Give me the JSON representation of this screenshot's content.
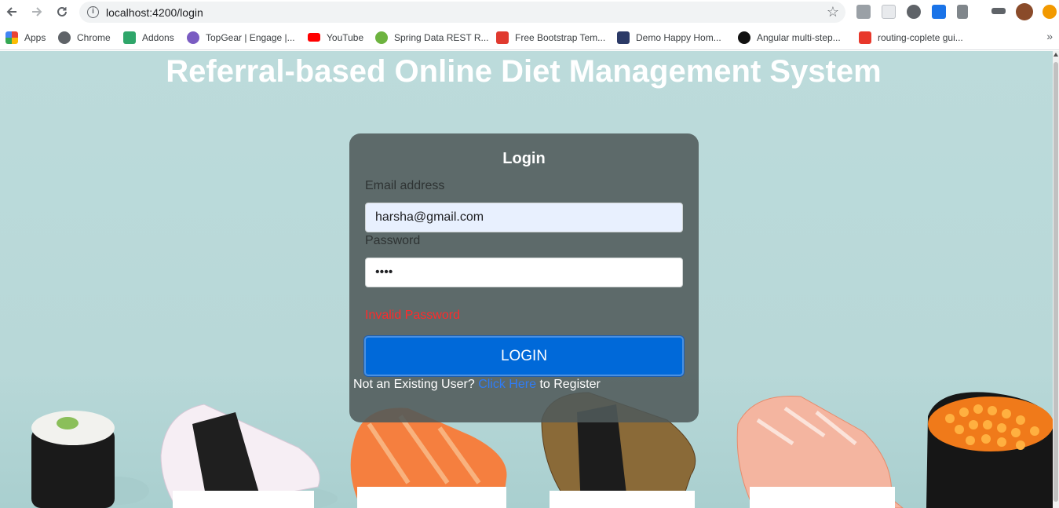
{
  "browser": {
    "url": "localhost:4200/login",
    "bookmarks": [
      {
        "label": "Apps",
        "color": "#ea4335"
      },
      {
        "label": "Chrome",
        "color": "#5f6368"
      },
      {
        "label": "Addons",
        "color": "#2fa66a"
      },
      {
        "label": "TopGear | Engage |...",
        "color": "#7a5cc2"
      },
      {
        "label": "YouTube",
        "color": "#ff0000"
      },
      {
        "label": "Spring Data REST R...",
        "color": "#6db33f"
      },
      {
        "label": "Free Bootstrap Tem...",
        "color": "#e03a2f"
      },
      {
        "label": "Demo Happy Hom...",
        "color": "#2b3a67"
      },
      {
        "label": "Angular multi-step...",
        "color": "#111111"
      },
      {
        "label": "routing-coplete gui...",
        "color": "#e8382b"
      }
    ],
    "more_icon": "»",
    "info_icon": "i",
    "star_icon": "☆"
  },
  "page": {
    "title": "Referral-based Online Diet Management System"
  },
  "login": {
    "title": "Login",
    "email_label": "Email address",
    "email_value": "harsha@gmail.com",
    "password_label": "Password",
    "password_value": "••••",
    "error": "Invalid Password",
    "button": "LOGIN",
    "register_prefix": "Not an Existing User?",
    "register_link": "Click Here",
    "register_suffix": "to Register"
  },
  "colors": {
    "background": "#bcdbdb",
    "card": "#5a6565",
    "button": "#0069d9",
    "error": "#ff2a2a",
    "link": "#2f7cf6"
  }
}
